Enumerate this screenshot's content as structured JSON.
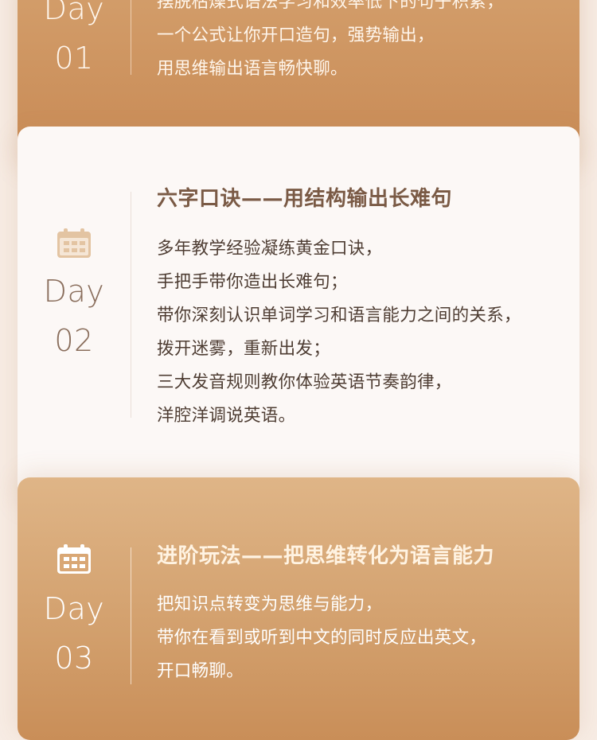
{
  "cards": [
    {
      "day_word": "Day",
      "day_num": "01",
      "lines": [
        "摆脱枯燥式语法学习和效率低下的句子积累，",
        "一个公式让你开口造句，强势输出，",
        "用思维输出语言畅快聊。"
      ]
    },
    {
      "icon": "calendar-icon",
      "day_word": "Day",
      "day_num": "02",
      "title": "六字口诀——用结构输出长难句",
      "lines": [
        "多年教学经验凝练黄金口诀，",
        "手把手带你造出长难句；",
        "带你深刻认识单词学习和语言能力之间的关系，",
        "拨开迷雾，重新出发；",
        "三大发音规则教你体验英语节奏韵律，",
        "洋腔洋调说英语。"
      ]
    },
    {
      "icon": "calendar-icon",
      "day_word": "Day",
      "day_num": "03",
      "title": "进阶玩法——把思维转化为语言能力",
      "lines": [
        "把知识点转变为思维与能力，",
        "带你在看到或听到中文的同时反应出英文，",
        "开口畅聊。"
      ]
    }
  ],
  "colors": {
    "card1_bg": "#cc9360",
    "card2_bg": "#fcf8f6",
    "card3_bg": "#d8aa78",
    "calendar_icon_card2": "#e3c4a2",
    "calendar_icon_card3": "#ffffff"
  }
}
